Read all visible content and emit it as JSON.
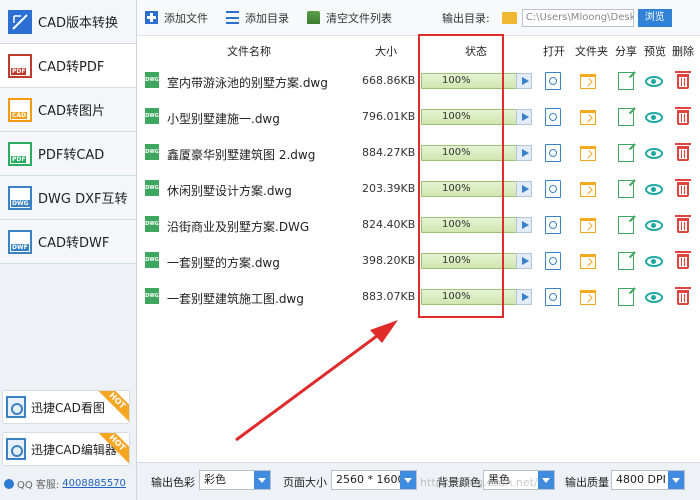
{
  "sidebar": {
    "items": [
      {
        "label": "CAD版本转换",
        "icon": "cad-version-icon"
      },
      {
        "label": "CAD转PDF",
        "icon": "cad-pdf-icon"
      },
      {
        "label": "CAD转图片",
        "icon": "cad-image-icon"
      },
      {
        "label": "PDF转CAD",
        "icon": "pdf-cad-icon"
      },
      {
        "label": "DWG DXF互转",
        "icon": "dwg-dxf-icon"
      },
      {
        "label": "CAD转DWF",
        "icon": "cad-dwf-icon"
      }
    ],
    "promos": [
      {
        "label": "迅捷CAD看图",
        "badge": "HOT"
      },
      {
        "label": "迅捷CAD编辑器",
        "badge": "HOT"
      }
    ],
    "qq_label": "QQ 客服:",
    "qq_number": "4008885570",
    "icon_tags": [
      "CAD",
      "PDF",
      "DWG",
      "DWF"
    ]
  },
  "toolbar": {
    "add_file": "添加文件",
    "add_dir": "添加目录",
    "clear_list": "清空文件列表",
    "output_dir_label": "输出目录:",
    "output_dir_value": "C:\\Users\\Mloong\\Desktop",
    "browse": "浏览"
  },
  "table": {
    "headers": {
      "name": "文件名称",
      "size": "大小",
      "status": "状态",
      "open": "打开",
      "folder": "文件夹",
      "share": "分享",
      "preview": "预览",
      "delete": "删除"
    },
    "file_type_tag": "DWG",
    "rows": [
      {
        "name": "室内带游泳池的别墅方案.dwg",
        "size": "668.86KB",
        "progress": "100%"
      },
      {
        "name": "小型别墅建施一.dwg",
        "size": "796.01KB",
        "progress": "100%"
      },
      {
        "name": "鑫厦豪华别墅建筑图 2.dwg",
        "size": "884.27KB",
        "progress": "100%"
      },
      {
        "name": "休闲别墅设计方案.dwg",
        "size": "203.39KB",
        "progress": "100%"
      },
      {
        "name": "沿街商业及别墅方案.DWG",
        "size": "824.40KB",
        "progress": "100%"
      },
      {
        "name": "一套别墅的方案.dwg",
        "size": "398.20KB",
        "progress": "100%"
      },
      {
        "name": "一套别墅建筑施工图.dwg",
        "size": "883.07KB",
        "progress": "100%"
      }
    ]
  },
  "bottombar": {
    "color_label": "输出色彩",
    "color_value": "彩色",
    "page_size_label": "页面大小",
    "page_size_value": "2560 * 1600",
    "bg_color_label": "背景颜色",
    "bg_color_value": "黑色",
    "quality_label": "输出质量",
    "quality_value": "4800 DPI"
  },
  "annotation": {
    "highlight_color": "#e02b2b",
    "arrow_color": "#e02b2b"
  },
  "watermark": "https://blog.csdn.net/..."
}
